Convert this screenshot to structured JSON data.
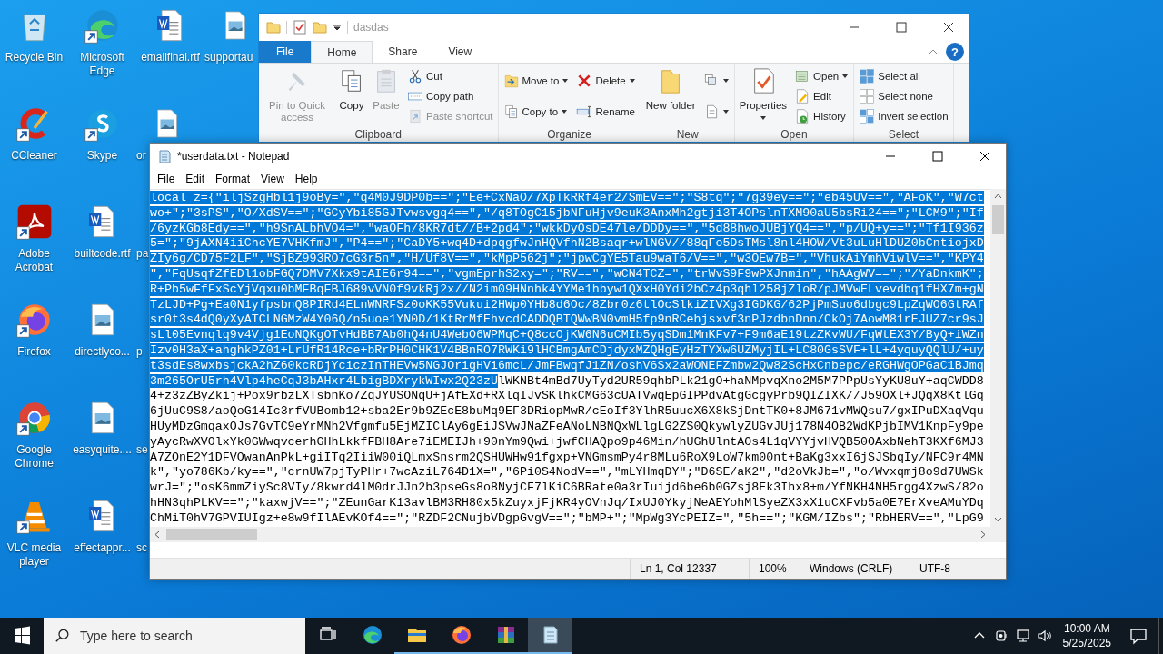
{
  "desktop": {
    "icons": [
      {
        "label": "Recycle Bin",
        "kind": "recycle",
        "shortcut": false,
        "cut": false
      },
      {
        "label": "CCleaner",
        "kind": "ccleaner",
        "shortcut": true,
        "cut": false
      },
      {
        "label": "Adobe Acrobat",
        "kind": "acrobat",
        "shortcut": true,
        "cut": false
      },
      {
        "label": "Firefox",
        "kind": "firefox",
        "shortcut": true,
        "cut": false
      },
      {
        "label": "Google Chrome",
        "kind": "chrome",
        "shortcut": true,
        "cut": false
      },
      {
        "label": "VLC media player",
        "kind": "vlc",
        "shortcut": true,
        "cut": false
      },
      {
        "label": "Microsoft Edge",
        "kind": "edge",
        "shortcut": true,
        "cut": false
      },
      {
        "label": "Skype",
        "kind": "skype",
        "shortcut": true,
        "cut": false
      },
      {
        "label": "builtcode.rtf",
        "kind": "word",
        "shortcut": false,
        "cut": false
      },
      {
        "label": "directlyco...",
        "kind": "image",
        "shortcut": false,
        "cut": false
      },
      {
        "label": "easyquite....",
        "kind": "image",
        "shortcut": false,
        "cut": false
      },
      {
        "label": "effectappr...",
        "kind": "word",
        "shortcut": false,
        "cut": false
      },
      {
        "label": "emailfinal.rtf",
        "kind": "word",
        "shortcut": false,
        "cut": false
      },
      {
        "label": "or",
        "kind": "image",
        "shortcut": false,
        "cut": true
      },
      {
        "label": "pa",
        "kind": "covered",
        "cut": true
      },
      {
        "label": "p",
        "kind": "covered",
        "cut": true
      },
      {
        "label": "se",
        "kind": "covered",
        "cut": true
      },
      {
        "label": "sc",
        "kind": "covered",
        "cut": true
      },
      {
        "label": "supportau",
        "kind": "image",
        "shortcut": false,
        "cut": true
      }
    ]
  },
  "explorer": {
    "title": "dasdas",
    "help": "?",
    "tabs": [
      {
        "label": "File",
        "kind": "file",
        "selected": false
      },
      {
        "label": "Home",
        "kind": "tab",
        "selected": true
      },
      {
        "label": "Share",
        "kind": "tab",
        "selected": false
      },
      {
        "label": "View",
        "kind": "tab",
        "selected": false
      }
    ],
    "groups": [
      {
        "label": "Clipboard",
        "columns": [
          {
            "kind": "large",
            "items": [
              {
                "label": "Pin to Quick access",
                "disabled": true,
                "dropdown": false
              }
            ]
          },
          {
            "kind": "large",
            "items": [
              {
                "label": "Copy",
                "disabled": false,
                "dropdown": false
              }
            ]
          },
          {
            "kind": "large",
            "items": [
              {
                "label": "Paste",
                "disabled": true,
                "dropdown": false
              }
            ]
          },
          {
            "kind": "small",
            "items": [
              {
                "label": "Cut",
                "disabled": false,
                "dropdown": false
              },
              {
                "label": "Copy path",
                "disabled": false,
                "dropdown": false
              },
              {
                "label": "Paste shortcut",
                "disabled": true,
                "dropdown": false
              }
            ]
          }
        ]
      },
      {
        "label": "Organize",
        "columns": [
          {
            "kind": "small",
            "items": [
              {
                "label": "Move to",
                "disabled": false,
                "dropdown": true
              },
              {
                "label": "Copy to",
                "disabled": false,
                "dropdown": true
              }
            ]
          },
          {
            "kind": "small",
            "items": [
              {
                "label": "Delete",
                "disabled": false,
                "dropdown": true
              },
              {
                "label": "Rename",
                "disabled": false,
                "dropdown": false
              }
            ]
          }
        ]
      },
      {
        "label": "New",
        "columns": [
          {
            "kind": "large",
            "items": [
              {
                "label": "New folder",
                "disabled": false,
                "dropdown": false
              }
            ]
          },
          {
            "kind": "small",
            "items": [
              {
                "disabled": false,
                "dropdown": true
              },
              {
                "disabled": false,
                "dropdown": true
              }
            ]
          }
        ]
      },
      {
        "label": "Open",
        "columns": [
          {
            "kind": "large",
            "items": [
              {
                "label": "Properties",
                "disabled": false,
                "dropdown": true
              }
            ]
          },
          {
            "kind": "small",
            "items": [
              {
                "label": "Open",
                "disabled": false,
                "dropdown": true
              },
              {
                "label": "Edit",
                "disabled": false,
                "dropdown": false
              },
              {
                "label": "History",
                "disabled": false,
                "dropdown": false
              }
            ]
          }
        ]
      },
      {
        "label": "Select",
        "columns": [
          {
            "kind": "small",
            "items": [
              {
                "label": "Select all",
                "disabled": false,
                "dropdown": false
              },
              {
                "label": "Select none",
                "disabled": false,
                "dropdown": false
              },
              {
                "label": "Invert selection",
                "disabled": false,
                "dropdown": false
              }
            ]
          }
        ]
      }
    ]
  },
  "notepad": {
    "title": "*userdata.txt - Notepad",
    "menu": [
      "File",
      "Edit",
      "Format",
      "View",
      "Help"
    ],
    "lines": [
      {
        "segments": [
          {
            "text": "local z={\"iljSzgHbl1j9oBy=\",\"q4M0J9DP0b==\";\"Ee+CxNaO/7XpTkRRf4er2/SmEV==\";\"S8tq\";\"7g39ey==\";\"eb45UV==\",\"AFoK\",\"W7ct",
            "selected": true
          }
        ]
      },
      {
        "segments": [
          {
            "text": "wo+\";\"3sPS\",\"O/XdSV==\";\"GCyYbi85GJTvwsvgq4==\",\"/q8TOgC15jbNFuHjv9euK3AnxMh2gtji3T4OPslnTXM90aU5bsRi24==\";\"LCM9\";\"If",
            "selected": true
          }
        ]
      },
      {
        "segments": [
          {
            "text": "/6yzKGb8Edy==\",\"h9SnALbhVO4=\",\"waOFh/8KR7dt//B+2pd4\";\"wkkDyOsDE47le/DDDy==\",\"5d88hwoJUBjYQ4==\",\"p/UQ+y==\";\"Tf1I936z",
            "selected": true
          }
        ]
      },
      {
        "segments": [
          {
            "text": "5=\";\"9jAXN4iiChcYE7VHKfmJ\",\"P4==\";\"CaDY5+wq4D+dpqgfwJnHQVfhN2Bsaqr+wlNGV//88qFo5DsTMsl8nl4HOW/Vt3uLuHlDUZ0bCntiojxD",
            "selected": true
          }
        ]
      },
      {
        "segments": [
          {
            "text": "ZIy6g/CD75F2LF\",\"SjBZ993RO7cG3r5n\",\"H/Uf8V==\",\"kMpP562j\";\"jpwCgYE5Tau9waT6/V==\",\"w3OEw7B=\",\"VhukAiYmhViwlV==\",\"KPY4",
            "selected": true
          }
        ]
      },
      {
        "segments": [
          {
            "text": "\",\"FqUsqfZfEDl1obFGQ7DMV7Xkx9tAIE6r94==\",\"vgmEprhS2xy=\";\"RV==\",\"wCN4TCZ=\",\"trWvS9F9wPXJnmin\",\"hAAgWV==\";\"/YaDnkmK\";",
            "selected": true
          }
        ]
      },
      {
        "segments": [
          {
            "text": "R+Pb5wFfFxScYjVqxu0bMFBqFBJ689vVN0f9vkRj2x//N2im09HNnhk4YYMe1hbyw1QXxH0Ydi2bCz4p3qhl258jZloR/pJMVwELvevdbq1fHX7m+gN",
            "selected": true
          }
        ]
      },
      {
        "segments": [
          {
            "text": "TzLJD+Pg+Ea0N1yfpsbnQ8PIRd4ELnWNRFSz0oKK55Vukui2HWp0YHb8d6Oc/8Zbr0z6tlOcSlkiZIVXg3IGDKG/62PjPmSuo6dbgc9LpZqWO6GtRAf",
            "selected": true
          }
        ]
      },
      {
        "segments": [
          {
            "text": "sr0t3s4dQ0yXyATCLNGMzW4Y06Q/n5uoe1YN0D/1KtRrMfEhvcdCADDQBTQWwBN0vmH5fp9nRCehjsxvf3nPJzdbnDnn/CkOj7AowM81rEJUZ7cr9sJ",
            "selected": true
          }
        ]
      },
      {
        "segments": [
          {
            "text": "sLl05Evnqlq9v4Vjg1EoNQKgOTvHdBB7Ab0hQ4nU4WebO6WPMqC+Q8ccOjKW6N6uCMIb5yqSDm1MnKFv7+F9m6aE19tzZKvWU/FqWtEX3Y/ByQ+iWZn",
            "selected": true
          }
        ]
      },
      {
        "segments": [
          {
            "text": "Izv0H3aX+ahghkPZ01+LrUfR14Rce+bRrPH0CHK1V4BBnRO7RWKi9lHCBmgAmCDjdyxMZQHgEyHzTYXw6UZMyjIL+LC80GsSVF+lL+4yquyQQlU/+uy",
            "selected": true
          }
        ]
      },
      {
        "segments": [
          {
            "text": "t3sdEs8wxbsjckA2hZ60kcRDjYciczInTHEVw5NGJOrigHVi6mcL/JmFBwqfJ1ZN/oshV6Sx2aWONEFZmbw2Qw82ScHxCnbepc/eRGHWgOPGaC1BJmq",
            "selected": true
          }
        ]
      },
      {
        "segments": [
          {
            "text": "3m265OrU5rh4Vlp4heCqJ3bAHxr4LbigBDXrykWIwx2Q23zU",
            "selected": true
          },
          {
            "text": "lWKNBt4mBd7UyTyd2UR59qhbPLk21gO+haNMpvqXno2M5M7PPpUsYyKU8uY+aqCWDD8",
            "selected": false
          }
        ]
      },
      {
        "segments": [
          {
            "text": "4+z3zZByZkij+Pox9rbzLXTsbnKo7ZqJYUSONqU+jAfEXd+RXlqIJvSKlhkCMG63cUATVwqEpGIPPdvAtgGcgyPrb9QIZIXK//J59OXl+JQqX8KtlGq",
            "selected": false
          }
        ]
      },
      {
        "segments": [
          {
            "text": "6jUuC9S8/aoQoG14Ic3rfVUBomb12+sba2Er9b9ZEcE8buMq9EF3DRiopMwR/cEoIf3YlhR5uucX6X8kSjDntTK0+8JM671vMWQsu7/gxIPuDXaqVqu",
            "selected": false
          }
        ]
      },
      {
        "segments": [
          {
            "text": "HUyMDzGmqaxOJs7GvTC9eYrMNh2Vfgmfu5EjMZIClAy6gEiJSVwJNaZFeANoLNBNQxWLlgLG2ZS0QkywlyZUGvJUj178N4OB2WdKPjbIMV1KnpFy9pe",
            "selected": false
          }
        ]
      },
      {
        "segments": [
          {
            "text": "yAycRwXVOlxYk0GWwqvcerhGHhLkkfFBH8Are7iEMEIJh+90nYm9Qwi+jwfCHAQpo9p46Min/hUGhUlntAOs4L1qVYYjvHVQB50OAxbNehT3KXf6MJ3",
            "selected": false
          }
        ]
      },
      {
        "segments": [
          {
            "text": "A7ZOnE2Y1DFVOwanAnPkL+giITq2IiiW00iQLmxSnsrm2QSHUWHw91fgxp+VNGmsmPy4r8MLu6RoX9LoW7km00nt+BaKg3xxI6jSJSbqIy/NFC9r4MN",
            "selected": false
          }
        ]
      },
      {
        "segments": [
          {
            "text": "k\",\"yo786Kb/ky==\",\"crnUW7pjTyPHr+7wcAziL764D1X=\",\"6Pi0S4NodV==\",\"mLYHmqDY\";\"D6SE/aK2\",\"d2oVkJb=\",\"o/Wvxqmj8o9d7UWSk",
            "selected": false
          }
        ]
      },
      {
        "segments": [
          {
            "text": "wrJ=\";\"osK6mmZiySc8VIy/8kwrd4lM0drJJn2b3pseGs8o8NyjCF7lKiC6BRate0a3rIuijd6be6b0GZsj8Ek3Ihx8+m/YfNKH4NH5rgg4XzwS/82o",
            "selected": false
          }
        ]
      },
      {
        "segments": [
          {
            "text": "hHN3qhPLKV==\";\"kaxwjV==\";\"ZEunGarK13avlBM3RH80x5kZuyxjFjKR4yOVnJq/IxUJ0YkyjNeAEYohMlSyeZX3xX1uCXFvb5a0E7ErXveAMuYDq",
            "selected": false
          }
        ]
      },
      {
        "segments": [
          {
            "text": "ChMiT0hV7GPVIUIgz+e8w9fIlAEvKOf4==\";\"RZDF2CNujbVDgpGvgV==\";\"bMP+\";\"MpWg3YcPEIZ=\",\"5h==\";\"KGM/IZbs\";\"RbHERV==\",\"LpG9",
            "selected": false
          }
        ]
      }
    ],
    "status": [
      "Ln 1, Col 12337",
      "100%",
      "Windows (CRLF)",
      "UTF-8"
    ]
  },
  "taskbar": {
    "search": {
      "placeholder": "Type here to search"
    },
    "apps": [
      {
        "kind": "taskview",
        "running": false,
        "active": false
      },
      {
        "kind": "edge",
        "running": false,
        "active": false
      },
      {
        "kind": "explorer",
        "running": true,
        "active": false
      },
      {
        "kind": "firefox",
        "running": true,
        "active": false
      },
      {
        "kind": "winrar",
        "running": true,
        "active": false
      },
      {
        "kind": "notepad",
        "running": true,
        "active": true
      }
    ],
    "time": "10:00 AM",
    "date": "5/25/2025"
  }
}
